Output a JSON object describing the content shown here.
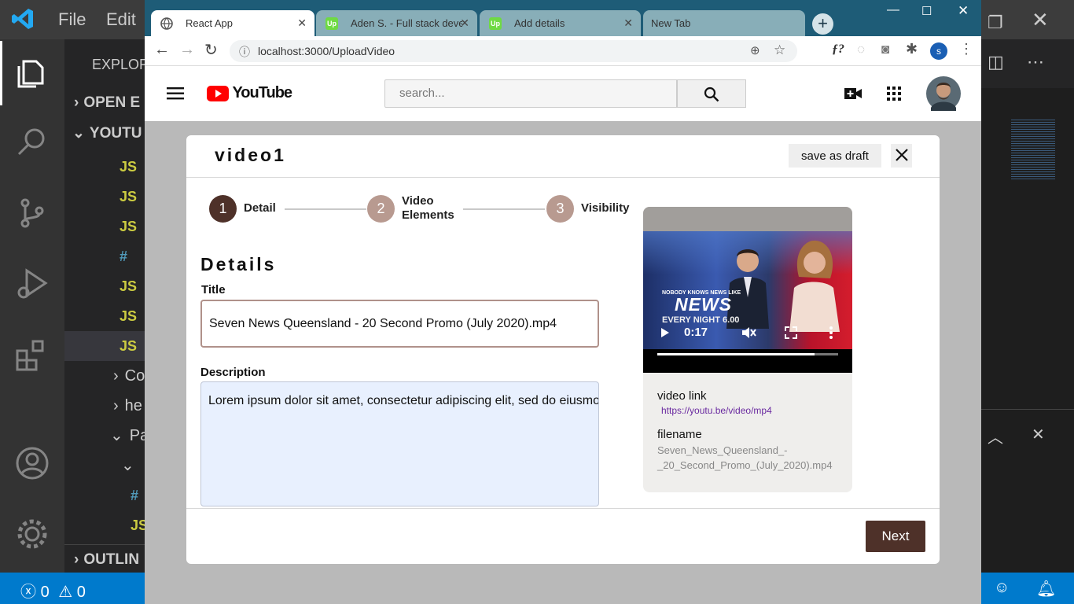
{
  "vscode": {
    "menu": [
      "File",
      "Edit"
    ],
    "sidebar_header": "EXPLOR",
    "sections": [
      "OPEN E",
      "YOUTU"
    ],
    "files": [
      {
        "icon": "JS",
        "kind": "js"
      },
      {
        "icon": "JS",
        "kind": "js"
      },
      {
        "icon": "JS",
        "kind": "js"
      },
      {
        "icon": "#",
        "kind": "css"
      },
      {
        "icon": "JS",
        "kind": "js"
      },
      {
        "icon": "JS",
        "kind": "js"
      },
      {
        "icon": "JS",
        "kind": "js"
      }
    ],
    "folders": [
      "Co",
      "he",
      "Pa"
    ],
    "nested": [
      {
        "icon": "#",
        "kind": "css"
      },
      {
        "icon": "JS",
        "kind": "js"
      }
    ],
    "outline_label": "OUTLIN",
    "status": {
      "errors": "0",
      "warnings": "0"
    }
  },
  "browser": {
    "tabs": [
      {
        "title": "React App",
        "active": true,
        "favicon": "globe-icon"
      },
      {
        "title": "Aden S. - Full stack develop",
        "active": false,
        "favicon": "upwork-icon"
      },
      {
        "title": "Add details",
        "active": false,
        "favicon": "upwork-icon"
      },
      {
        "title": "New Tab",
        "active": false,
        "favicon": ""
      }
    ],
    "url": "localhost:3000/UploadVideo",
    "profile_initial": "s"
  },
  "youtube": {
    "logo_text": "YouTube",
    "search_placeholder": "search..."
  },
  "modal": {
    "title": "video1",
    "save_draft_label": "save as draft",
    "steps": [
      {
        "number": "1",
        "label": "Detail",
        "active": true
      },
      {
        "number": "2",
        "label": "Video Elements",
        "active": false
      },
      {
        "number": "3",
        "label": "Visibility",
        "active": false
      }
    ],
    "section_heading": "Details",
    "title_label": "Title",
    "title_value": "Seven News Queensland - 20 Second Promo (July 2020).mp4",
    "description_label": "Description",
    "description_value": "Lorem ipsum dolor sit amet, consectetur adipiscing elit, sed do eiusmod tempor incididunt ut labore et dolore magna aliqua.",
    "next_label": "Next"
  },
  "preview": {
    "video_time": "0:17",
    "video_progress": 0.87,
    "overlay_top": "NOBODY KNOWS NEWS LIKE",
    "overlay_brand": "NEWS",
    "overlay_bottom": "EVERY NIGHT 6.00",
    "link_label": "video link",
    "link_value": "https://youtu.be/video/mp4",
    "filename_label": "filename",
    "filename_line1": "Seven_News_Queensland_-",
    "filename_line2": "_20_Second_Promo_(July_2020).mp4"
  },
  "colors": {
    "accent": "#4e3129",
    "step_active": "#4e3129",
    "step_inactive": "#b89a90",
    "tabstrip": "#1e5c77",
    "yt_red": "#ff0000"
  }
}
